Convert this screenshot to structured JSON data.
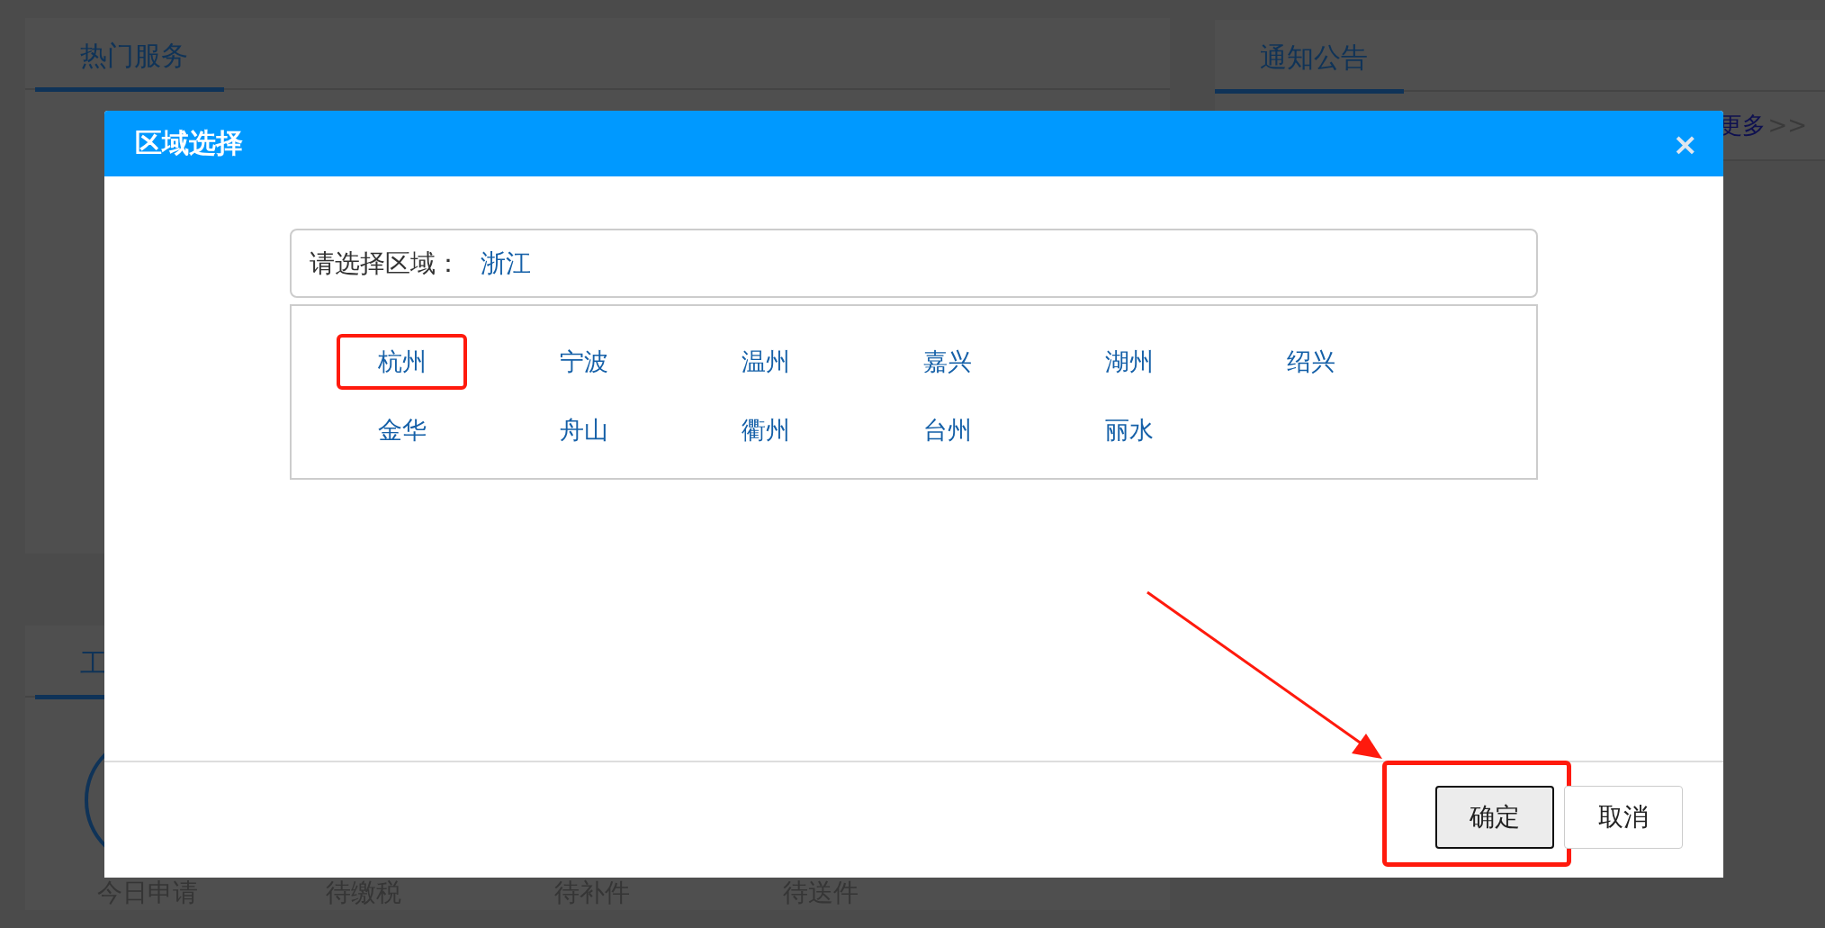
{
  "page": {
    "services_panel": {
      "title": "热门服务"
    },
    "notice_panel": {
      "title": "通知公告",
      "more_link": "更多",
      "more_arrows": ">>"
    },
    "work_panel": {
      "title": "工",
      "stats": [
        "今日申请",
        "待缴税",
        "待补件",
        "待送件"
      ]
    }
  },
  "dialog": {
    "title": "区域选择",
    "close": "×",
    "region_field": {
      "label": "请选择区域：",
      "value": "浙江"
    },
    "cities": [
      {
        "name": "杭州",
        "highlighted": true
      },
      {
        "name": "宁波",
        "highlighted": false
      },
      {
        "name": "温州",
        "highlighted": false
      },
      {
        "name": "嘉兴",
        "highlighted": false
      },
      {
        "name": "湖州",
        "highlighted": false
      },
      {
        "name": "绍兴",
        "highlighted": false
      },
      {
        "name": "金华",
        "highlighted": false
      },
      {
        "name": "舟山",
        "highlighted": false
      },
      {
        "name": "衢州",
        "highlighted": false
      },
      {
        "name": "台州",
        "highlighted": false
      },
      {
        "name": "丽水",
        "highlighted": false
      }
    ],
    "buttons": [
      {
        "label": "确定",
        "kind": "primary",
        "highlighted": true
      },
      {
        "label": "取消",
        "kind": "secondary",
        "highlighted": false
      }
    ]
  }
}
